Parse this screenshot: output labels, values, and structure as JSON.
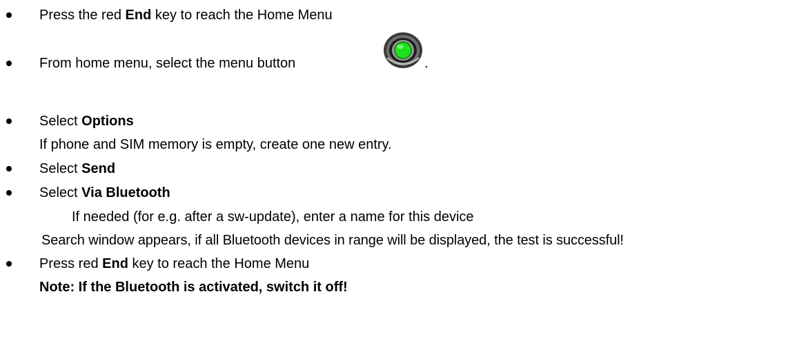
{
  "steps": [
    {
      "pre": "Press the red ",
      "bold": "End",
      "post": " key to reach the Home Menu"
    },
    {
      "pre": "From home menu, select the menu button",
      "post": "."
    },
    {
      "pre": "Select ",
      "bold": "Options"
    },
    {
      "pre": "Select ",
      "bold": "Send"
    },
    {
      "pre": "Select ",
      "bold": "Via Bluetooth"
    },
    {
      "pre": "Press red ",
      "bold": "End",
      "post": " key to reach the Home Menu"
    }
  ],
  "details": {
    "options_note": "If phone and SIM memory is empty, create one new entry.",
    "bluetooth_name": "If needed (for e.g. after a sw-update), enter a name for this device",
    "search_window": "Search window appears, if all Bluetooth devices in range will be displayed, the test is successful!",
    "final_note": "Note: If the Bluetooth is activated, switch it off!"
  },
  "icons": {
    "menu_button": "menu-button-icon"
  },
  "colors": {
    "menu_button_green": "#1fe01f",
    "menu_button_ring": "#2a2a2a"
  }
}
